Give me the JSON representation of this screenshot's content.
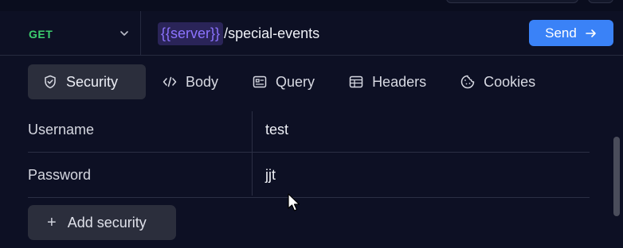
{
  "request": {
    "method": "GET",
    "url_variable": "{{server}}",
    "url_path": "/special-events",
    "send_label": "Send"
  },
  "tabs": [
    {
      "label": "Security",
      "icon": "shield-icon",
      "active": true
    },
    {
      "label": "Body",
      "icon": "code-icon",
      "active": false
    },
    {
      "label": "Query",
      "icon": "query-icon",
      "active": false
    },
    {
      "label": "Headers",
      "icon": "headers-icon",
      "active": false
    },
    {
      "label": "Cookies",
      "icon": "cookie-icon",
      "active": false
    }
  ],
  "security": {
    "rows": [
      {
        "key": "Username",
        "value": "test"
      },
      {
        "key": "Password",
        "value": "jjt"
      }
    ],
    "add_label": "Add security"
  },
  "colors": {
    "background": "#0d1024",
    "method_get": "#3ccf6e",
    "variable": "#8c73ff",
    "send_button": "#3a82f7"
  }
}
